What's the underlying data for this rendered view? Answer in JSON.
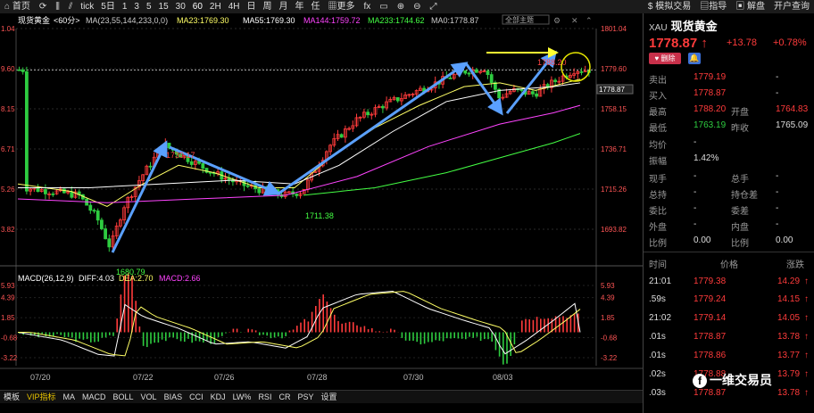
{
  "toolbar": {
    "left": [
      {
        "icon": "home-icon",
        "label": "首页"
      },
      {
        "icon": "refresh-icon",
        "label": ""
      },
      {
        "icon": "bars-icon",
        "label": ""
      },
      {
        "icon": "chart-icon",
        "label": ""
      }
    ],
    "periods": [
      "tick",
      "5日",
      "1",
      "3",
      "5",
      "15",
      "30",
      "60",
      "2H",
      "4H",
      "日",
      "周",
      "月",
      "年",
      "任"
    ],
    "active_period": "60",
    "tools": [
      "更多",
      "fx"
    ],
    "right": [
      "模拟交易",
      "指导",
      "解盘",
      "开户查询"
    ]
  },
  "ma_bar": {
    "symbol": "现货黄金",
    "period": "<60分>",
    "ma": "MA(23,55,144,233,0,0)",
    "ma23": "MA23:1769.30",
    "ma55": "MA55:1769.30",
    "ma144": "MA144:1759.72",
    "ma233": "MA233:1744.62",
    "ma0": "MA0:1778.87",
    "colors": {
      "ma23": "#ffff66",
      "ma55": "#ffffff",
      "ma144": "#ff44ff",
      "ma233": "#44ff44"
    }
  },
  "dropdown": "全部主题",
  "price_axis": [
    "1801.04",
    "1779.60",
    "1758.15",
    "1736.71",
    "1715.26",
    "1693.82"
  ],
  "price_axis_left": [
    "1.04",
    "9.60",
    "8.15",
    "6.71",
    "5.26",
    "3.82"
  ],
  "current_price_label": "1778.87",
  "annotations": {
    "high": "1739.17",
    "low": "1680.79",
    "mid_low": "1711.38",
    "top": "1788.20"
  },
  "macd": {
    "label": "MACD(26,12,9)",
    "diff": "DIFF:4.03",
    "dea": "DEA:2.70",
    "macd": "MACD:2.66",
    "axis": [
      "5.93",
      "4.39",
      "1.85",
      "-0.68",
      "-3.22"
    ],
    "axis_left": [
      "5.93",
      "4.39",
      "1.85",
      "-0.68",
      "-3.22"
    ]
  },
  "dates": [
    "07/20",
    "07/22",
    "07/26",
    "07/28",
    "07/30",
    "08/03"
  ],
  "bottom_tabs": [
    "模板",
    "VIP指标",
    "MA",
    "MACD",
    "BOLL",
    "VOL",
    "BIAS",
    "CCI",
    "KDJ",
    "LW%",
    "RSI",
    "CR",
    "PSY",
    "设置"
  ],
  "active_bottom_tab": "VIP指标",
  "panel": {
    "symbol": "XAU",
    "name": "现货黄金",
    "price": "1778.87",
    "arrow": "↑",
    "change": "+13.78",
    "change_pct": "+0.78%",
    "delete_label": "删除",
    "rows": [
      {
        "k1": "卖出",
        "v1": "1779.19",
        "c1": "red",
        "k2": "",
        "v2": "-",
        "c2": "wht"
      },
      {
        "k1": "买入",
        "v1": "1778.87",
        "c1": "red",
        "k2": "",
        "v2": "-",
        "c2": "wht"
      },
      {
        "k1": "最高",
        "v1": "1788.20",
        "c1": "red",
        "k2": "开盘",
        "v2": "1764.83",
        "c2": "red"
      },
      {
        "k1": "最低",
        "v1": "1763.19",
        "c1": "green",
        "k2": "昨收",
        "v2": "1765.09",
        "c2": "wht"
      },
      {
        "k1": "均价",
        "v1": "-",
        "c1": "wht",
        "k2": "",
        "v2": "",
        "c2": "wht"
      },
      {
        "k1": "振幅",
        "v1": "1.42%",
        "c1": "wht",
        "k2": "",
        "v2": "",
        "c2": "wht"
      },
      {
        "k1": "现手",
        "v1": "-",
        "c1": "wht",
        "k2": "总手",
        "v2": "-",
        "c2": "wht"
      },
      {
        "k1": "总持",
        "v1": "-",
        "c1": "wht",
        "k2": "持仓差",
        "v2": "-",
        "c2": "wht"
      },
      {
        "k1": "委比",
        "v1": "-",
        "c1": "wht",
        "k2": "委差",
        "v2": "-",
        "c2": "wht"
      },
      {
        "k1": "外盘",
        "v1": "-",
        "c1": "wht",
        "k2": "内盘",
        "v2": "-",
        "c2": "wht"
      },
      {
        "k1": "比例",
        "v1": "0.00",
        "c1": "wht",
        "k2": "比例",
        "v2": "0.00",
        "c2": "wht"
      }
    ],
    "tick_header": [
      "时间",
      "价格",
      "涨跌"
    ],
    "ticks": [
      {
        "t": "21:01",
        "p": "1779.38",
        "d": "14.29"
      },
      {
        "t": ".59s",
        "p": "1779.24",
        "d": "14.15"
      },
      {
        "t": "21:02",
        "p": "1779.14",
        "d": "14.05"
      },
      {
        "t": ".01s",
        "p": "1778.87",
        "d": "13.78"
      },
      {
        "t": ".01s",
        "p": "1778.86",
        "d": "13.77"
      },
      {
        "t": ".02s",
        "p": "1778.88",
        "d": "13.79"
      },
      {
        "t": ".03s",
        "p": "1778.87",
        "d": "13.78"
      }
    ]
  },
  "watermark": "一维交易员"
}
